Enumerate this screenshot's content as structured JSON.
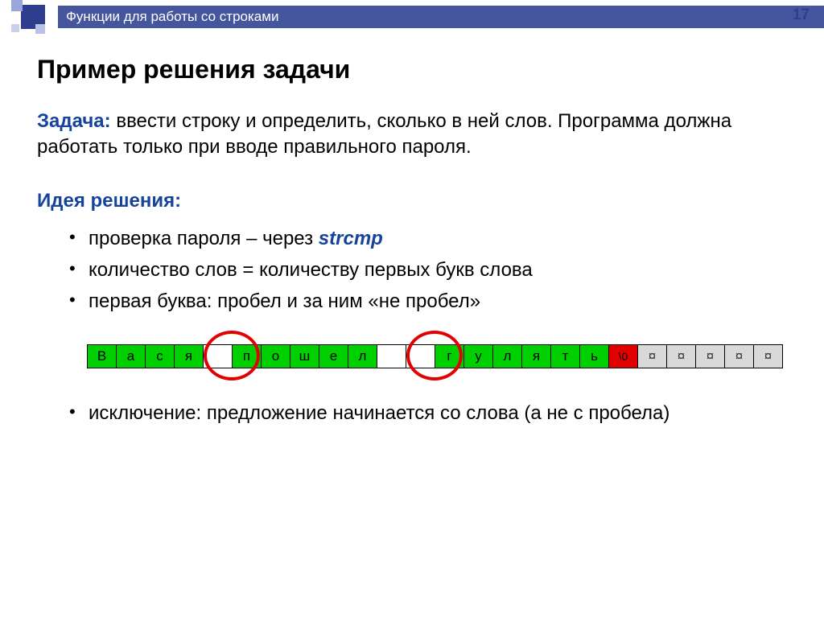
{
  "header": {
    "breadcrumb": "Функции для работы со строками",
    "page_number": "17"
  },
  "title": "Пример решения задачи",
  "task": {
    "label": "Задача:",
    "text": "ввести строку и определить, сколько в ней слов. Программа должна работать только при вводе правильного пароля."
  },
  "idea": {
    "label": "Идея решения:",
    "items": [
      {
        "prefix": "проверка пароля – через ",
        "code": "strcmp",
        "suffix": ""
      },
      {
        "text": "количество слов = количеству первых букв слова"
      },
      {
        "text": "первая буква: пробел и за ним «не пробел»"
      },
      {
        "text": "исключение: предложение начинается со слова (а не с пробела)"
      }
    ]
  },
  "string_cells": [
    {
      "ch": "В",
      "cls": ""
    },
    {
      "ch": "а",
      "cls": ""
    },
    {
      "ch": "с",
      "cls": ""
    },
    {
      "ch": "я",
      "cls": ""
    },
    {
      "ch": "",
      "cls": "space"
    },
    {
      "ch": "п",
      "cls": ""
    },
    {
      "ch": "о",
      "cls": ""
    },
    {
      "ch": "ш",
      "cls": ""
    },
    {
      "ch": "е",
      "cls": ""
    },
    {
      "ch": "л",
      "cls": ""
    },
    {
      "ch": "",
      "cls": "space"
    },
    {
      "ch": "",
      "cls": "space"
    },
    {
      "ch": "г",
      "cls": ""
    },
    {
      "ch": "у",
      "cls": ""
    },
    {
      "ch": "л",
      "cls": ""
    },
    {
      "ch": "я",
      "cls": ""
    },
    {
      "ch": "т",
      "cls": ""
    },
    {
      "ch": "ь",
      "cls": ""
    },
    {
      "ch": "\\0",
      "cls": "nul"
    },
    {
      "ch": "¤",
      "cls": "gar"
    },
    {
      "ch": "¤",
      "cls": "gar"
    },
    {
      "ch": "¤",
      "cls": "gar"
    },
    {
      "ch": "¤",
      "cls": "gar"
    },
    {
      "ch": "¤",
      "cls": "gar"
    }
  ],
  "circles": [
    {
      "left_cell_index": 4
    },
    {
      "left_cell_index": 11
    }
  ]
}
